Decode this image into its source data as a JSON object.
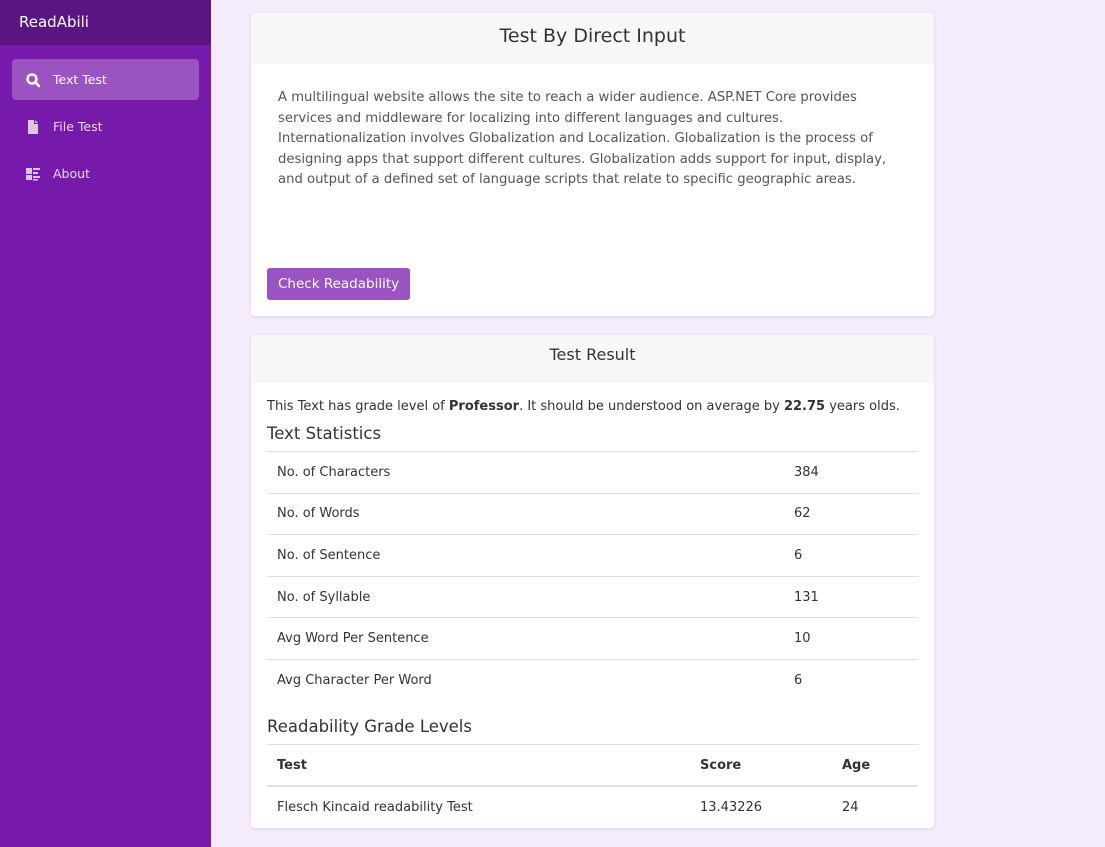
{
  "app": {
    "title": "ReadAbili"
  },
  "sidebar": {
    "items": [
      {
        "label": "Text Test",
        "icon": "search-icon"
      },
      {
        "label": "File Test",
        "icon": "file-icon"
      },
      {
        "label": "About",
        "icon": "list-icon"
      }
    ]
  },
  "input_card": {
    "title": "Test By Direct Input",
    "text": "A multilingual website allows the site to reach a wider audience. ASP.NET Core provides services and middleware for localizing into different languages and cultures. Internationalization involves Globalization and Localization. Globalization is the process of designing apps that support different cultures. Globalization adds support for input, display, and output of a defined set of language scripts that relate to specific geographic areas.",
    "button": "Check Readability"
  },
  "result": {
    "title": "Test Result",
    "summary_pre": "This Text has grade level of ",
    "grade": "Professor",
    "summary_mid": ". It should be understood on average by ",
    "age": "22.75",
    "summary_post": " years olds.",
    "stats_title": "Text Statistics",
    "stats": [
      {
        "label": "No. of Characters",
        "value": "384"
      },
      {
        "label": "No. of Words",
        "value": "62"
      },
      {
        "label": "No. of Sentence",
        "value": "6"
      },
      {
        "label": "No. of Syllable",
        "value": "131"
      },
      {
        "label": "Avg Word Per Sentence",
        "value": "10"
      },
      {
        "label": "Avg Character Per Word",
        "value": "6"
      }
    ],
    "grades_title": "Readability Grade Levels",
    "grades_headers": {
      "test": "Test",
      "score": "Score",
      "age": "Age"
    },
    "grades": [
      {
        "test": "Flesch Kincaid readability Test",
        "score": "13.43226",
        "age": "24"
      }
    ]
  }
}
